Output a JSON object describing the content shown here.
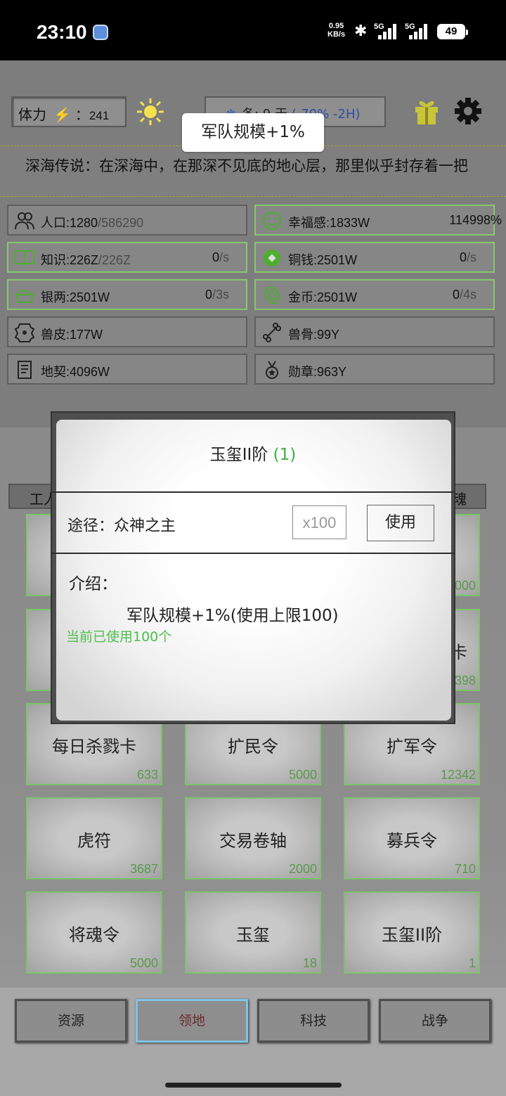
{
  "status": {
    "time": "23:10",
    "net_speed": "0.95",
    "net_unit": "KB/s",
    "sig1": "5G",
    "sig2": "5G",
    "battery": "49"
  },
  "topbar": {
    "stamina_label": "体力",
    "stamina_sep": "：",
    "stamina_value": "241",
    "season_text": "冬: 9 天 ",
    "season_buff": "(-70% -2H)",
    "tooltip": "军队规模+1%",
    "marquee": "深海传说：在深海中，在那深不见底的地心层，那里似乎封存着一把"
  },
  "resources": [
    {
      "icon": "people-icon",
      "name": "人口:1280",
      "max": "/586290",
      "rate": "",
      "unit": "",
      "green": false
    },
    {
      "icon": "smile-icon",
      "name": "幸福感:1833W",
      "max": "",
      "rate": "",
      "unit": "",
      "pct": "114998%",
      "green": true
    },
    {
      "icon": "book-icon",
      "name": "知识:226Z",
      "max": "/226Z",
      "rate": "0",
      "unit": "/s",
      "green": true
    },
    {
      "icon": "coin-icon",
      "name": "铜钱:2501W",
      "max": "",
      "rate": "0",
      "unit": "/s",
      "green": true
    },
    {
      "icon": "ingot-icon",
      "name": "银两:2501W",
      "max": "",
      "rate": "0",
      "unit": "/3s",
      "green": true
    },
    {
      "icon": "gold-icon",
      "name": "金币:2501W",
      "max": "",
      "rate": "0",
      "unit": "/4s",
      "green": true
    },
    {
      "icon": "hide-icon",
      "name": "兽皮:177W",
      "max": "",
      "rate": "",
      "unit": "",
      "green": false
    },
    {
      "icon": "bone-icon",
      "name": "兽骨:99Y",
      "max": "",
      "rate": "",
      "unit": "",
      "green": false
    },
    {
      "icon": "deed-icon",
      "name": "地契:4096W",
      "max": "",
      "rate": "",
      "unit": "",
      "green": false
    },
    {
      "icon": "medal-icon",
      "name": "勋章:963Y",
      "max": "",
      "rate": "",
      "unit": "",
      "green": false
    }
  ],
  "tabs_partial": {
    "left": "工人",
    "right": "魂"
  },
  "cards_partial": [
    {
      "count": "000"
    },
    {
      "title": "卡",
      "count": "398"
    }
  ],
  "cards": [
    {
      "title": "每日杀戮卡",
      "count": "633"
    },
    {
      "title": "扩民令",
      "count": "5000"
    },
    {
      "title": "扩军令",
      "count": "12342"
    },
    {
      "title": "虎符",
      "count": "3687"
    },
    {
      "title": "交易卷轴",
      "count": "2000"
    },
    {
      "title": "募兵令",
      "count": "710"
    },
    {
      "title": "将魂令",
      "count": "5000"
    },
    {
      "title": "玉玺",
      "count": "18"
    },
    {
      "title": "玉玺II阶",
      "count": "1"
    }
  ],
  "nav": [
    "资源",
    "领地",
    "科技",
    "战争"
  ],
  "modal": {
    "title": "玉玺II阶",
    "qty": "(1)",
    "route_label": "途径：众神之主",
    "qty_placeholder": "x100",
    "use_label": "使用",
    "intro_label": "介绍：",
    "intro_text": "军队规模+1%(使用上限100)",
    "used_text": "当前已使用100个"
  }
}
